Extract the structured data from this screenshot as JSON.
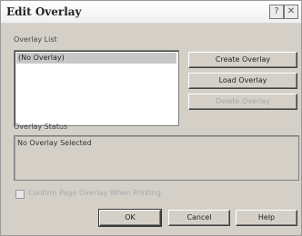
{
  "window": {
    "title": "Edit Overlay",
    "help_glyph": "?",
    "close_glyph": "✕"
  },
  "overlay_list": {
    "label": "Overlay List",
    "items": [
      "(No Overlay)"
    ],
    "selected_index": 0
  },
  "buttons": {
    "create": "Create Overlay",
    "load": "Load Overlay",
    "delete": "Delete Overlay",
    "ok": "OK",
    "cancel": "Cancel",
    "help": "Help"
  },
  "overlay_status": {
    "label": "Overlay Status",
    "text": "No Overlay Selected"
  },
  "confirm_checkbox": {
    "label": "Confirm Page Overlay When Printing",
    "checked": false,
    "enabled": false
  }
}
